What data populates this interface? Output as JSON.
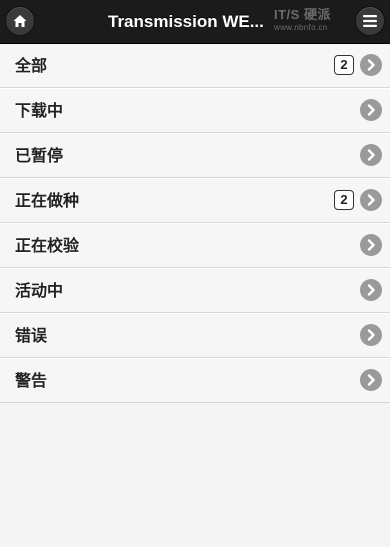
{
  "header": {
    "title": "Transmission WE...",
    "home_icon": "home-icon",
    "menu_icon": "menu-icon"
  },
  "watermark": {
    "line1": "IT/S 硬派",
    "line2": "www.nbnfo.cn"
  },
  "list": {
    "items": [
      {
        "label": "全部",
        "count": "2"
      },
      {
        "label": "下载中",
        "count": null
      },
      {
        "label": "已暂停",
        "count": null
      },
      {
        "label": "正在做种",
        "count": "2"
      },
      {
        "label": "正在校验",
        "count": null
      },
      {
        "label": "活动中",
        "count": null
      },
      {
        "label": "错误",
        "count": null
      },
      {
        "label": "警告",
        "count": null
      }
    ],
    "arrow_icon": "chevron-right-icon"
  },
  "colors": {
    "header_bg": "#1b1b1b",
    "list_bg": "#f6f6f6",
    "arrow_bg": "#9a9a9a"
  }
}
